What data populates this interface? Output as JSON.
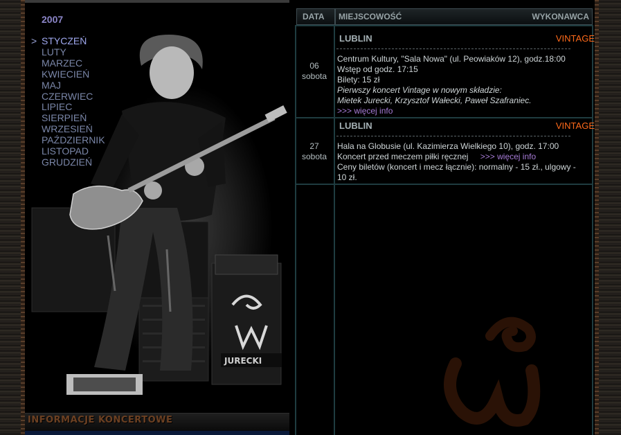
{
  "sidebar": {
    "year": "2007",
    "active_marker": ">",
    "months": [
      "STYCZEŃ",
      "LUTY",
      "MARZEC",
      "KWIECIEŃ",
      "MAJ",
      "CZERWIEC",
      "LIPIEC",
      "SIERPIEŃ",
      "WRZESIEŃ",
      "PAŹDZIERNIK",
      "LISTOPAD",
      "GRUDZIEŃ"
    ],
    "active_month": "STYCZEŃ",
    "caption": "INFORMACJE KONCERTOWE",
    "amp_label": "JURECKI"
  },
  "table": {
    "headers": {
      "date": "DATA",
      "place": "MIEJSCOWOŚĆ",
      "artist": "WYKONAWCA"
    },
    "events": [
      {
        "city": "LUBLIN",
        "artist": "VINTAGE",
        "day": "06",
        "weekday": "sobota",
        "venue": "Centrum Kultury, \"Sala Nowa\" (ul. Peowiaków 12), godz.18:00",
        "entry": "Wstęp od godz. 17:15",
        "tickets": "Bilety: 15 zł",
        "note1": "Pierwszy koncert Vintage w nowym składzie:",
        "note2": "Mietek Jurecki, Krzysztof Wałecki, Paweł Szafraniec.",
        "more": ">>> więcej info"
      },
      {
        "city": "LUBLIN",
        "artist": "VINTAGE",
        "day": "27",
        "weekday": "sobota",
        "venue": "Hala na Globusie (ul. Kazimierza Wielkiego 10), godz. 17:00",
        "desc": "Koncert przed meczem piłki ręcznej",
        "more": ">>> więcej info",
        "prices1": "Ceny biletów (koncert i mecz łącznie): normalny - 15 zł., ulgowy -",
        "prices2": "10 zł."
      }
    ]
  },
  "colors": {
    "accent": "#ff6a1a",
    "link": "#a67bd6",
    "menu": "#7a86a8",
    "grid": "#1f3c40"
  }
}
